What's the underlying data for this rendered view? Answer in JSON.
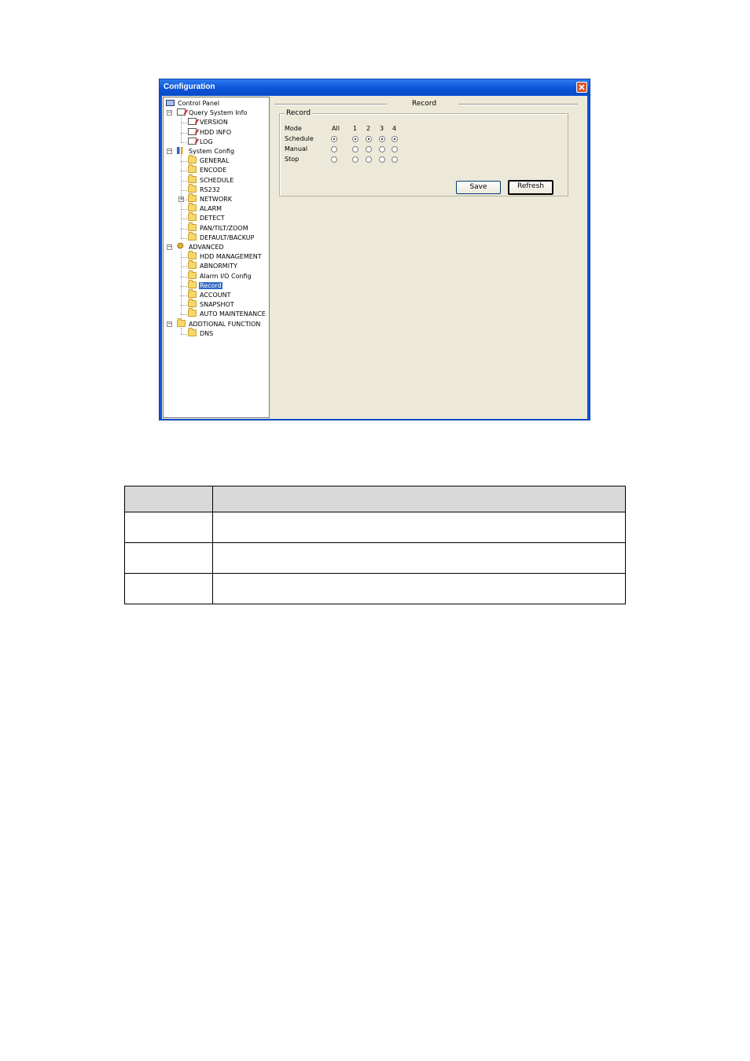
{
  "window": {
    "title": "Configuration"
  },
  "tree": {
    "items": [
      {
        "label": "Control Panel",
        "icon": "monitor-icon"
      },
      {
        "label": "Query System Info",
        "icon": "notes-icon"
      },
      {
        "label": "VERSION",
        "icon": "notes-icon"
      },
      {
        "label": "HDD INFO",
        "icon": "notes-icon"
      },
      {
        "label": "LOG",
        "icon": "notes-icon"
      },
      {
        "label": "System Config",
        "icon": "settings-icon"
      },
      {
        "label": "GENERAL",
        "icon": "folder-icon"
      },
      {
        "label": "ENCODE",
        "icon": "folder-icon"
      },
      {
        "label": "SCHEDULE",
        "icon": "folder-icon"
      },
      {
        "label": "RS232",
        "icon": "folder-icon"
      },
      {
        "label": "NETWORK",
        "icon": "folder-icon"
      },
      {
        "label": "ALARM",
        "icon": "folder-icon"
      },
      {
        "label": "DETECT",
        "icon": "folder-icon"
      },
      {
        "label": "PAN/TILT/ZOOM",
        "icon": "folder-icon"
      },
      {
        "label": "DEFAULT/BACKUP",
        "icon": "folder-icon"
      },
      {
        "label": "ADVANCED",
        "icon": "gears-icon"
      },
      {
        "label": "HDD MANAGEMENT",
        "icon": "folder-icon"
      },
      {
        "label": "ABNORMITY",
        "icon": "folder-icon"
      },
      {
        "label": "Alarm I/O Config",
        "icon": "folder-icon"
      },
      {
        "label": "Record",
        "icon": "open-folder-icon",
        "selected": true
      },
      {
        "label": "ACCOUNT",
        "icon": "folder-icon"
      },
      {
        "label": "SNAPSHOT",
        "icon": "folder-icon"
      },
      {
        "label": "AUTO MAINTENANCE",
        "icon": "folder-icon"
      },
      {
        "label": "ADDTIONAL FUNCTION",
        "icon": "folder-icon"
      },
      {
        "label": "DNS",
        "icon": "folder-icon"
      }
    ]
  },
  "panel": {
    "header": "Record",
    "group_label": "Record",
    "columns": [
      "Mode",
      "All",
      "1",
      "2",
      "3",
      "4"
    ],
    "rows": [
      {
        "label": "Schedule",
        "values": [
          true,
          true,
          true,
          true,
          true
        ]
      },
      {
        "label": "Manual",
        "values": [
          false,
          false,
          false,
          false,
          false
        ]
      },
      {
        "label": "Stop",
        "values": [
          false,
          false,
          false,
          false,
          false
        ]
      }
    ],
    "save_label": "Save",
    "refresh_label": "Refresh"
  },
  "doc_table": {
    "rows": [
      [
        "",
        ""
      ],
      [
        "",
        ""
      ],
      [
        "",
        ""
      ],
      [
        "",
        ""
      ]
    ]
  }
}
